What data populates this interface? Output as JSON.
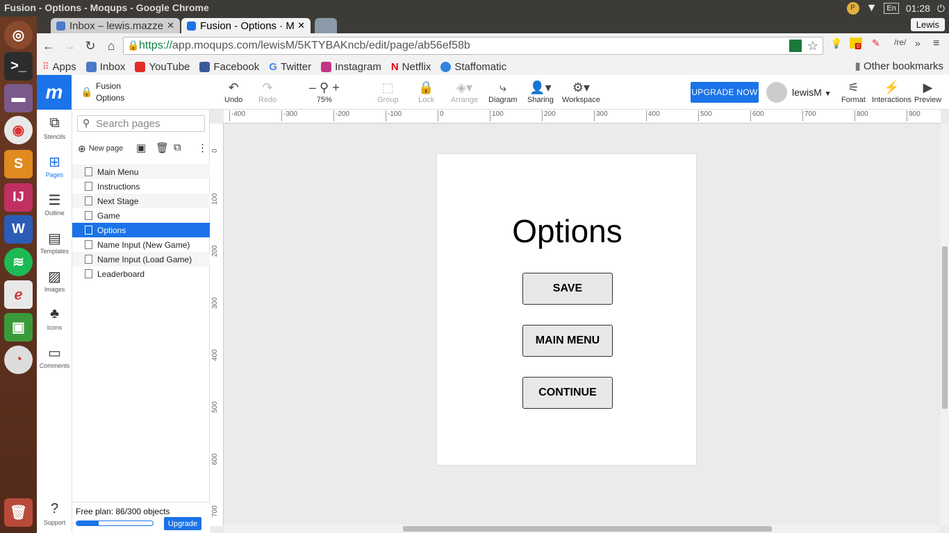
{
  "os": {
    "window_title": "Fusion - Options - Moqups - Google Chrome",
    "clock": "01:28",
    "keyboard": "En",
    "tray_indicator": "P"
  },
  "browser": {
    "tabs": [
      {
        "label": "Inbox – lewis.mazze",
        "close": "✕"
      },
      {
        "label": "Fusion - Options · M",
        "close": "✕"
      }
    ],
    "profile": "Lewis",
    "url_https": "https://",
    "url_rest": "app.moqups.com/lewisM/5KTYBAKncb/edit/page/ab56ef58b",
    "ext_badge": "0",
    "ext_text": "/re/",
    "ext_more": "»",
    "bookmarks": [
      "Apps",
      "Inbox",
      "YouTube",
      "Facebook",
      "Twitter",
      "Instagram",
      "Netflix",
      "Staffomatic"
    ],
    "other_bookmarks": "Other bookmarks"
  },
  "app": {
    "logo": "m",
    "project_name": "Fusion",
    "page_name": "Options",
    "toolbar": {
      "undo": "Undo",
      "redo": "Redo",
      "zoom": "75%",
      "zoom_minus": "–",
      "zoom_plus": "+",
      "group": "Group",
      "lock": "Lock",
      "arrange": "Arrange",
      "diagram": "Diagram",
      "sharing": "Sharing",
      "workspace": "Workspace",
      "upgrade": "UPGRADE NOW",
      "user": "lewisM",
      "format": "Format",
      "interactions": "Interactions",
      "preview": "Preview"
    },
    "rail": [
      "Stencils",
      "Pages",
      "Outline",
      "Templates",
      "Images",
      "Icons",
      "Comments",
      "Support"
    ],
    "search_placeholder": "Search pages",
    "new_page": "New page",
    "pages": [
      "Main Menu",
      "Instructions",
      "Next Stage",
      "Game",
      "Options",
      "Name Input (New Game)",
      "Name Input (Load Game)",
      "Leaderboard"
    ],
    "selected_page": "Options",
    "free_plan": "Free plan: 86/300 objects",
    "plan_progress": 0.29,
    "upgrade_small": "Upgrade",
    "ruler_h": [
      "-400",
      "-300",
      "-200",
      "-100",
      "0",
      "100",
      "200",
      "300",
      "400",
      "500",
      "600",
      "700",
      "800",
      "900"
    ],
    "ruler_v": [
      "0",
      "100",
      "200",
      "300",
      "400",
      "500",
      "600",
      "700"
    ],
    "canvas": {
      "title": "Options",
      "buttons": [
        "SAVE",
        "MAIN MENU",
        "CONTINUE"
      ]
    }
  }
}
